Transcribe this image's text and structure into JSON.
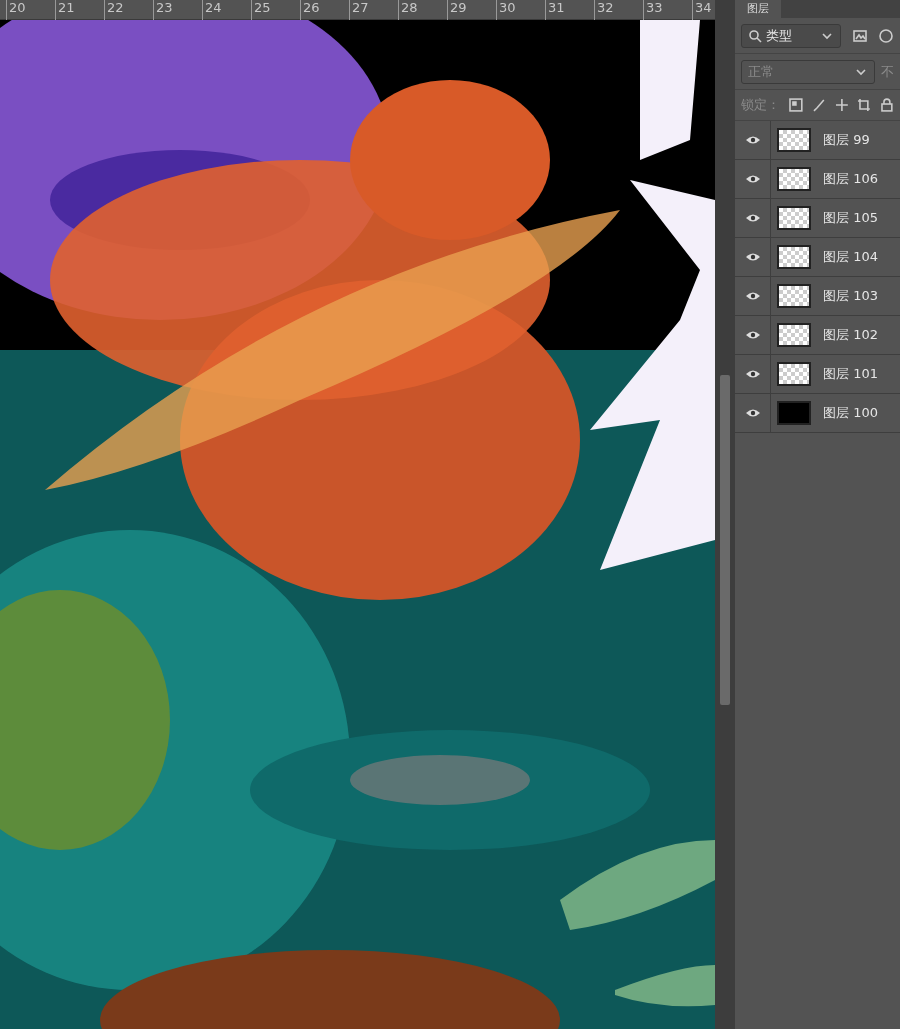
{
  "ruler": {
    "labels": [
      "20",
      "21",
      "22",
      "23",
      "24",
      "25",
      "26",
      "27",
      "28",
      "29",
      "30",
      "31",
      "32",
      "33",
      "34"
    ]
  },
  "panel": {
    "tab": "图层",
    "filter": {
      "value": "类型"
    },
    "blend_mode": {
      "value": "正常",
      "disabled": true
    },
    "opacity_label": "不",
    "lock_label": "锁定："
  },
  "layers": [
    {
      "name": "图层 99",
      "visible": true,
      "kind": "transparent"
    },
    {
      "name": "图层 106",
      "visible": true,
      "kind": "transparent"
    },
    {
      "name": "图层 105",
      "visible": true,
      "kind": "transparent"
    },
    {
      "name": "图层 104",
      "visible": true,
      "kind": "transparent"
    },
    {
      "name": "图层 103",
      "visible": true,
      "kind": "transparent"
    },
    {
      "name": "图层 102",
      "visible": true,
      "kind": "transparent"
    },
    {
      "name": "图层 101",
      "visible": true,
      "kind": "transparent"
    },
    {
      "name": "图层 100",
      "visible": true,
      "kind": "solid"
    }
  ]
}
